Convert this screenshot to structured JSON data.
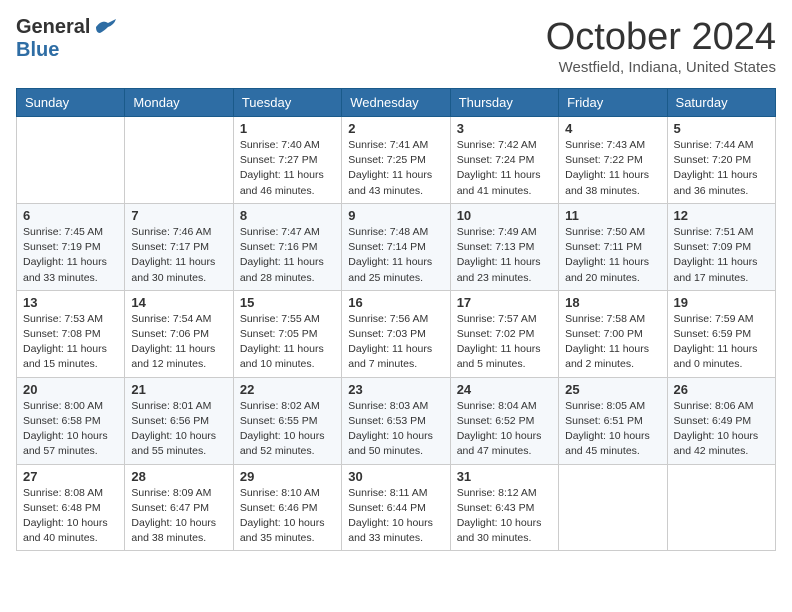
{
  "header": {
    "logo_general": "General",
    "logo_blue": "Blue",
    "month": "October 2024",
    "location": "Westfield, Indiana, United States"
  },
  "days_of_week": [
    "Sunday",
    "Monday",
    "Tuesday",
    "Wednesday",
    "Thursday",
    "Friday",
    "Saturday"
  ],
  "weeks": [
    [
      {
        "day": "",
        "sunrise": "",
        "sunset": "",
        "daylight": ""
      },
      {
        "day": "",
        "sunrise": "",
        "sunset": "",
        "daylight": ""
      },
      {
        "day": "1",
        "sunrise": "Sunrise: 7:40 AM",
        "sunset": "Sunset: 7:27 PM",
        "daylight": "Daylight: 11 hours and 46 minutes."
      },
      {
        "day": "2",
        "sunrise": "Sunrise: 7:41 AM",
        "sunset": "Sunset: 7:25 PM",
        "daylight": "Daylight: 11 hours and 43 minutes."
      },
      {
        "day": "3",
        "sunrise": "Sunrise: 7:42 AM",
        "sunset": "Sunset: 7:24 PM",
        "daylight": "Daylight: 11 hours and 41 minutes."
      },
      {
        "day": "4",
        "sunrise": "Sunrise: 7:43 AM",
        "sunset": "Sunset: 7:22 PM",
        "daylight": "Daylight: 11 hours and 38 minutes."
      },
      {
        "day": "5",
        "sunrise": "Sunrise: 7:44 AM",
        "sunset": "Sunset: 7:20 PM",
        "daylight": "Daylight: 11 hours and 36 minutes."
      }
    ],
    [
      {
        "day": "6",
        "sunrise": "Sunrise: 7:45 AM",
        "sunset": "Sunset: 7:19 PM",
        "daylight": "Daylight: 11 hours and 33 minutes."
      },
      {
        "day": "7",
        "sunrise": "Sunrise: 7:46 AM",
        "sunset": "Sunset: 7:17 PM",
        "daylight": "Daylight: 11 hours and 30 minutes."
      },
      {
        "day": "8",
        "sunrise": "Sunrise: 7:47 AM",
        "sunset": "Sunset: 7:16 PM",
        "daylight": "Daylight: 11 hours and 28 minutes."
      },
      {
        "day": "9",
        "sunrise": "Sunrise: 7:48 AM",
        "sunset": "Sunset: 7:14 PM",
        "daylight": "Daylight: 11 hours and 25 minutes."
      },
      {
        "day": "10",
        "sunrise": "Sunrise: 7:49 AM",
        "sunset": "Sunset: 7:13 PM",
        "daylight": "Daylight: 11 hours and 23 minutes."
      },
      {
        "day": "11",
        "sunrise": "Sunrise: 7:50 AM",
        "sunset": "Sunset: 7:11 PM",
        "daylight": "Daylight: 11 hours and 20 minutes."
      },
      {
        "day": "12",
        "sunrise": "Sunrise: 7:51 AM",
        "sunset": "Sunset: 7:09 PM",
        "daylight": "Daylight: 11 hours and 17 minutes."
      }
    ],
    [
      {
        "day": "13",
        "sunrise": "Sunrise: 7:53 AM",
        "sunset": "Sunset: 7:08 PM",
        "daylight": "Daylight: 11 hours and 15 minutes."
      },
      {
        "day": "14",
        "sunrise": "Sunrise: 7:54 AM",
        "sunset": "Sunset: 7:06 PM",
        "daylight": "Daylight: 11 hours and 12 minutes."
      },
      {
        "day": "15",
        "sunrise": "Sunrise: 7:55 AM",
        "sunset": "Sunset: 7:05 PM",
        "daylight": "Daylight: 11 hours and 10 minutes."
      },
      {
        "day": "16",
        "sunrise": "Sunrise: 7:56 AM",
        "sunset": "Sunset: 7:03 PM",
        "daylight": "Daylight: 11 hours and 7 minutes."
      },
      {
        "day": "17",
        "sunrise": "Sunrise: 7:57 AM",
        "sunset": "Sunset: 7:02 PM",
        "daylight": "Daylight: 11 hours and 5 minutes."
      },
      {
        "day": "18",
        "sunrise": "Sunrise: 7:58 AM",
        "sunset": "Sunset: 7:00 PM",
        "daylight": "Daylight: 11 hours and 2 minutes."
      },
      {
        "day": "19",
        "sunrise": "Sunrise: 7:59 AM",
        "sunset": "Sunset: 6:59 PM",
        "daylight": "Daylight: 11 hours and 0 minutes."
      }
    ],
    [
      {
        "day": "20",
        "sunrise": "Sunrise: 8:00 AM",
        "sunset": "Sunset: 6:58 PM",
        "daylight": "Daylight: 10 hours and 57 minutes."
      },
      {
        "day": "21",
        "sunrise": "Sunrise: 8:01 AM",
        "sunset": "Sunset: 6:56 PM",
        "daylight": "Daylight: 10 hours and 55 minutes."
      },
      {
        "day": "22",
        "sunrise": "Sunrise: 8:02 AM",
        "sunset": "Sunset: 6:55 PM",
        "daylight": "Daylight: 10 hours and 52 minutes."
      },
      {
        "day": "23",
        "sunrise": "Sunrise: 8:03 AM",
        "sunset": "Sunset: 6:53 PM",
        "daylight": "Daylight: 10 hours and 50 minutes."
      },
      {
        "day": "24",
        "sunrise": "Sunrise: 8:04 AM",
        "sunset": "Sunset: 6:52 PM",
        "daylight": "Daylight: 10 hours and 47 minutes."
      },
      {
        "day": "25",
        "sunrise": "Sunrise: 8:05 AM",
        "sunset": "Sunset: 6:51 PM",
        "daylight": "Daylight: 10 hours and 45 minutes."
      },
      {
        "day": "26",
        "sunrise": "Sunrise: 8:06 AM",
        "sunset": "Sunset: 6:49 PM",
        "daylight": "Daylight: 10 hours and 42 minutes."
      }
    ],
    [
      {
        "day": "27",
        "sunrise": "Sunrise: 8:08 AM",
        "sunset": "Sunset: 6:48 PM",
        "daylight": "Daylight: 10 hours and 40 minutes."
      },
      {
        "day": "28",
        "sunrise": "Sunrise: 8:09 AM",
        "sunset": "Sunset: 6:47 PM",
        "daylight": "Daylight: 10 hours and 38 minutes."
      },
      {
        "day": "29",
        "sunrise": "Sunrise: 8:10 AM",
        "sunset": "Sunset: 6:46 PM",
        "daylight": "Daylight: 10 hours and 35 minutes."
      },
      {
        "day": "30",
        "sunrise": "Sunrise: 8:11 AM",
        "sunset": "Sunset: 6:44 PM",
        "daylight": "Daylight: 10 hours and 33 minutes."
      },
      {
        "day": "31",
        "sunrise": "Sunrise: 8:12 AM",
        "sunset": "Sunset: 6:43 PM",
        "daylight": "Daylight: 10 hours and 30 minutes."
      },
      {
        "day": "",
        "sunrise": "",
        "sunset": "",
        "daylight": ""
      },
      {
        "day": "",
        "sunrise": "",
        "sunset": "",
        "daylight": ""
      }
    ]
  ]
}
